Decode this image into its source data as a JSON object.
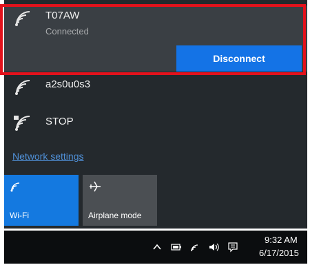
{
  "networks": [
    {
      "name": "T07AW",
      "status": "Connected",
      "secured": false
    },
    {
      "name": "a2s0u0s3",
      "secured": false
    },
    {
      "name": "STOP",
      "secured": true
    }
  ],
  "actions": {
    "disconnect_label": "Disconnect"
  },
  "settings_link": "Network settings",
  "quick_actions": [
    {
      "label": "Wi-Fi",
      "icon": "wifi-icon",
      "active": true
    },
    {
      "label": "Airplane mode",
      "icon": "airplane-icon",
      "active": false
    }
  ],
  "taskbar": {
    "tray_icons": [
      "chevron-up-icon",
      "battery-icon",
      "wifi-icon",
      "volume-icon",
      "action-center-icon"
    ],
    "time": "9:32 AM",
    "date": "6/17/2015"
  },
  "colors": {
    "accent": "#1479e0",
    "highlight_border": "#e3121c",
    "flyout_bg": "#24292d",
    "taskbar_bg": "#0b0d0f"
  }
}
